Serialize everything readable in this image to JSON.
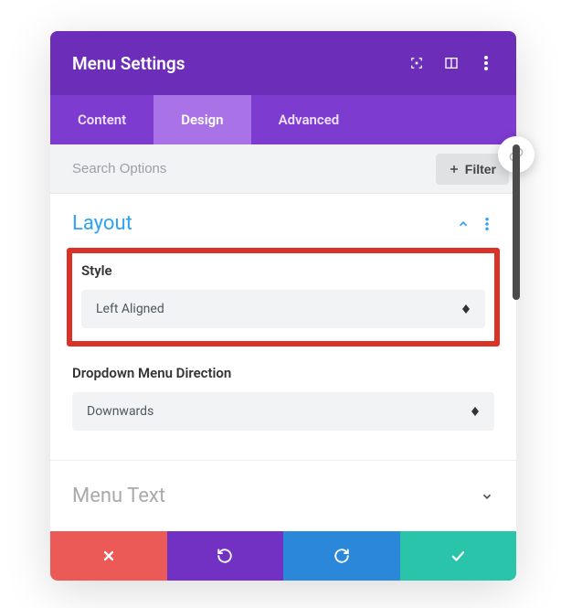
{
  "header": {
    "title": "Menu Settings"
  },
  "tabs": [
    {
      "label": "Content",
      "active": false
    },
    {
      "label": "Design",
      "active": true
    },
    {
      "label": "Advanced",
      "active": false
    }
  ],
  "search": {
    "placeholder": "Search Options",
    "filter_label": "Filter"
  },
  "sections": {
    "layout": {
      "title": "Layout",
      "fields": {
        "style": {
          "label": "Style",
          "value": "Left Aligned"
        },
        "direction": {
          "label": "Dropdown Menu Direction",
          "value": "Downwards"
        }
      }
    },
    "menu_text": {
      "title": "Menu Text"
    }
  }
}
